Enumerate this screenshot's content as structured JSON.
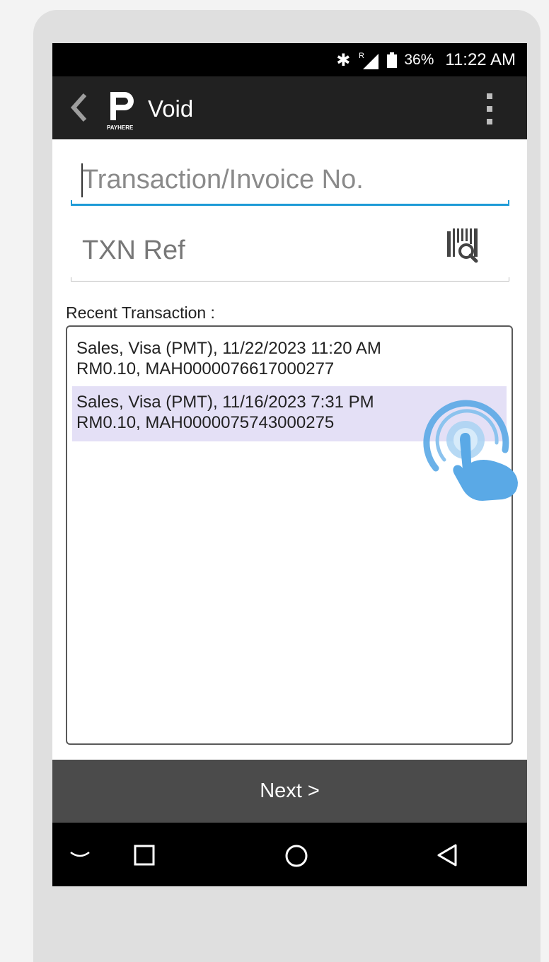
{
  "status_bar": {
    "bluetooth_icon": "bluetooth-icon",
    "signal_icon": "signal-roaming-icon",
    "signal_badge": "R",
    "battery_icon": "battery-icon",
    "battery_percent": "36%",
    "time": "11:22 AM"
  },
  "toolbar": {
    "title": "Void",
    "logo_caption": "PAYHERE",
    "back_icon": "chevron-left-icon",
    "menu_icon": "overflow-menu-icon"
  },
  "form": {
    "transaction_placeholder": "Transaction/Invoice No.",
    "txn_ref_placeholder": "TXN Ref",
    "barcode_icon": "barcode-scan-icon"
  },
  "recent": {
    "label": "Recent Transaction :",
    "items": [
      {
        "line1": "Sales, Visa (PMT), 11/22/2023 11:20 AM",
        "line2": "RM0.10, MAH0000076617000277",
        "selected": false
      },
      {
        "line1": "Sales, Visa (PMT), 11/16/2023 7:31 PM",
        "line2": "RM0.10, MAH0000075743000275",
        "selected": true
      }
    ]
  },
  "next_button": {
    "label": "Next >"
  },
  "nav_bar": [
    "hide-keyboard-icon",
    "recents-square-icon",
    "home-circle-icon",
    "back-triangle-icon"
  ],
  "colors": {
    "accent": "#1e9bd7",
    "selected_row": "#e4e0f6",
    "toolbar": "#212121",
    "next_bar": "#4b4b4b",
    "tap_hand": "#5aa9e6"
  }
}
